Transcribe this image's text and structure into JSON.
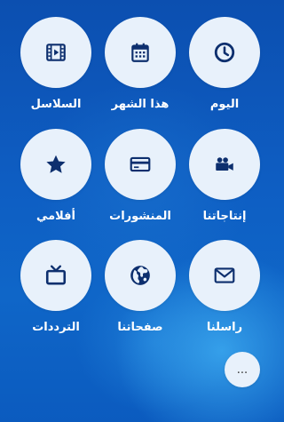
{
  "colors": {
    "background": "#0e5ec3",
    "circle": "#e8f1fb",
    "icon": "#0d2f6e",
    "label": "#ffffff"
  },
  "menu": {
    "items": [
      {
        "label": "اليوم",
        "icon": "clock-icon"
      },
      {
        "label": "هذا الشهر",
        "icon": "calendar-icon"
      },
      {
        "label": "السلاسل",
        "icon": "film-icon"
      },
      {
        "label": "إنتاجاتنا",
        "icon": "video-camera-icon"
      },
      {
        "label": "المنشورات",
        "icon": "credit-card-icon"
      },
      {
        "label": "أفلامي",
        "icon": "star-icon"
      },
      {
        "label": "راسلنا",
        "icon": "envelope-icon"
      },
      {
        "label": "صفحاتنا",
        "icon": "globe-icon"
      },
      {
        "label": "الترددات",
        "icon": "tv-icon"
      }
    ]
  },
  "more_button": {
    "label": "..."
  }
}
